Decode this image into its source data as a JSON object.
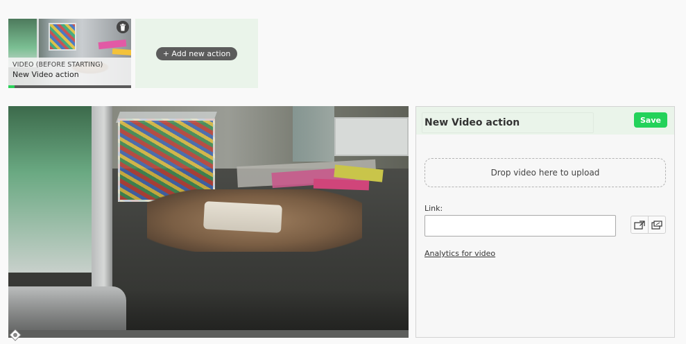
{
  "actions": {
    "items": [
      {
        "type_label": "VIDEO (BEFORE STARTING)",
        "title": "New Video action",
        "progress": 0.05
      }
    ],
    "add_label": "+ Add new action"
  },
  "editor": {
    "title": "New Video action",
    "save_label": "Save",
    "dropzone_text": "Drop video here to upload",
    "link_label": "Link:",
    "link_value": "",
    "analytics_label": "Analytics for video"
  },
  "colors": {
    "accent": "#23d25a",
    "header_bg": "#eaf4ea",
    "progress": "#2bd25a"
  },
  "icons": {
    "delete": "trash-icon",
    "open_link": "external-link-icon",
    "open_window": "popup-window-icon",
    "handle": "drag-handle-icon"
  }
}
